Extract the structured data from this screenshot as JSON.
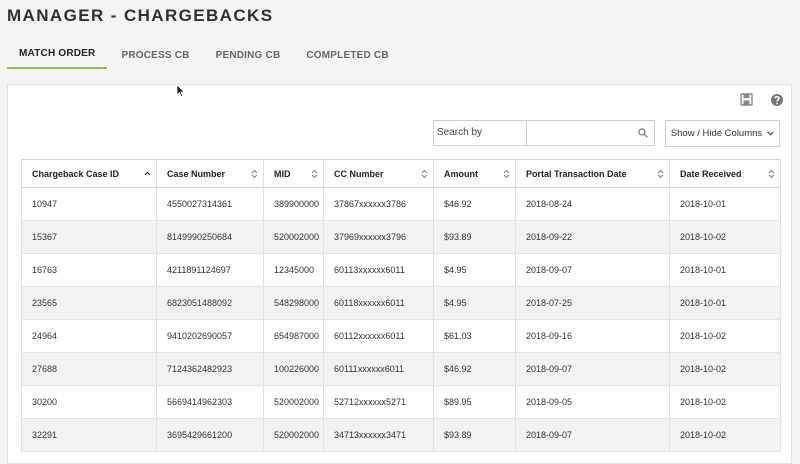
{
  "page": {
    "title": "MANAGER - CHARGEBACKS"
  },
  "tabs": [
    {
      "label": "MATCH ORDER",
      "active": true
    },
    {
      "label": "PROCESS CB",
      "active": false
    },
    {
      "label": "PENDING CB",
      "active": false
    },
    {
      "label": "COMPLETED CB",
      "active": false
    }
  ],
  "toolbar": {
    "save_icon": "save-icon",
    "help_icon": "help-icon",
    "search_label": "Search by",
    "search_value": "",
    "columns_button": "Show / Hide Columns"
  },
  "colors": {
    "accent": "#8bc34a",
    "row_alt": "#f2f2f2"
  },
  "table": {
    "columns": [
      {
        "label": "Chargeback Case ID",
        "sort": "asc"
      },
      {
        "label": "Case Number",
        "sort": "none"
      },
      {
        "label": "MID",
        "sort": "none"
      },
      {
        "label": "CC Number",
        "sort": "none"
      },
      {
        "label": "Amount",
        "sort": "none"
      },
      {
        "label": "Portal Transaction Date",
        "sort": "none"
      },
      {
        "label": "Date Received",
        "sort": "none"
      }
    ],
    "rows": [
      [
        "10947",
        "4550027314361",
        "389900000",
        "37867xxxxxx3786",
        "$46.92",
        "2018-08-24",
        "2018-10-01"
      ],
      [
        "15367",
        "8149990250684",
        "520002000",
        "37969xxxxxx3796",
        "$93.89",
        "2018-09-22",
        "2018-10-02"
      ],
      [
        "16763",
        "4211891124697",
        "12345000",
        "60113xxxxxx6011",
        "$4.95",
        "2018-09-07",
        "2018-10-01"
      ],
      [
        "23565",
        "6823051488092",
        "548298000",
        "60118xxxxxx6011",
        "$4.95",
        "2018-07-25",
        "2018-10-01"
      ],
      [
        "24964",
        "9410202690057",
        "654987000",
        "60112xxxxxx6011",
        "$61.03",
        "2018-09-16",
        "2018-10-02"
      ],
      [
        "27688",
        "7124362482923",
        "100226000",
        "60111xxxxxx6011",
        "$46.92",
        "2018-09-07",
        "2018-10-02"
      ],
      [
        "30200",
        "5669414962303",
        "520002000",
        "52712xxxxxx5271",
        "$89.95",
        "2018-09-05",
        "2018-10-02"
      ],
      [
        "32291",
        "3695429661200",
        "520002000",
        "34713xxxxxx3471",
        "$93.89",
        "2018-09-07",
        "2018-10-02"
      ]
    ]
  }
}
